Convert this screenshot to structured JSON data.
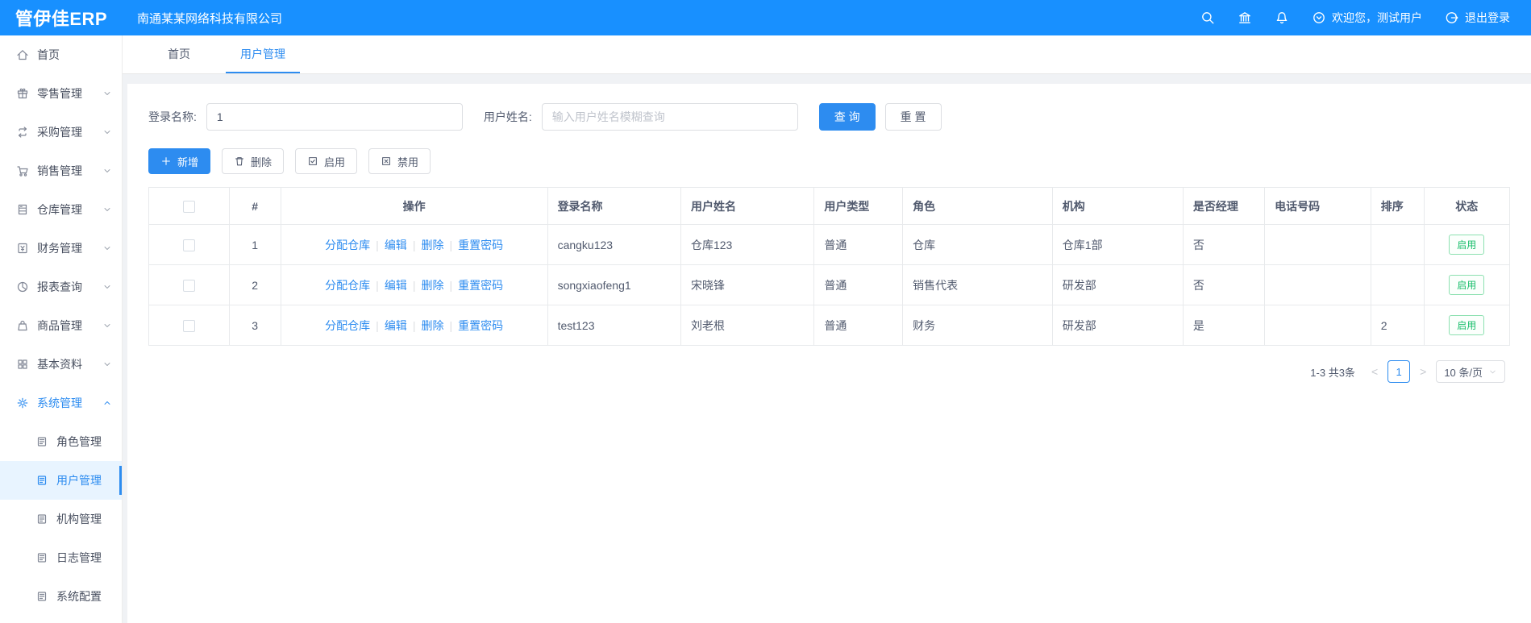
{
  "header": {
    "logo_text": "管伊佳ERP",
    "company_name": "南通某某网络科技有限公司",
    "welcome_text": "欢迎您，测试用户",
    "logout_text": "退出登录"
  },
  "tabs": [
    {
      "label": "首页"
    },
    {
      "label": "用户管理"
    }
  ],
  "sidebar": {
    "items": [
      {
        "id": "home",
        "label": "首页",
        "icon": "home",
        "level": 1
      },
      {
        "id": "retail",
        "label": "零售管理",
        "icon": "gift",
        "level": 1,
        "chevron": "down"
      },
      {
        "id": "purchase",
        "label": "采购管理",
        "icon": "repeat",
        "level": 1,
        "chevron": "down"
      },
      {
        "id": "sales",
        "label": "销售管理",
        "icon": "cart",
        "level": 1,
        "chevron": "down"
      },
      {
        "id": "warehouse",
        "label": "仓库管理",
        "icon": "cabinet",
        "level": 1,
        "chevron": "down"
      },
      {
        "id": "finance",
        "label": "财务管理",
        "icon": "finance",
        "level": 1,
        "chevron": "down"
      },
      {
        "id": "reports",
        "label": "报表查询",
        "icon": "pie",
        "level": 1,
        "chevron": "down"
      },
      {
        "id": "products",
        "label": "商品管理",
        "icon": "bag",
        "level": 1,
        "chevron": "down"
      },
      {
        "id": "basic-data",
        "label": "基本资料",
        "icon": "grid",
        "level": 1,
        "chevron": "down"
      },
      {
        "id": "system",
        "label": "系统管理",
        "icon": "gear",
        "level": 1,
        "chevron": "up",
        "highlight": true
      },
      {
        "id": "role-mgmt",
        "label": "角色管理",
        "icon": "doc",
        "level": 2
      },
      {
        "id": "user-mgmt",
        "label": "用户管理",
        "icon": "doc",
        "level": 2,
        "active": true
      },
      {
        "id": "org-mgmt",
        "label": "机构管理",
        "icon": "doc",
        "level": 2
      },
      {
        "id": "log-mgmt",
        "label": "日志管理",
        "icon": "doc",
        "level": 2
      },
      {
        "id": "system-config",
        "label": "系统配置",
        "icon": "doc",
        "level": 2
      }
    ]
  },
  "search": {
    "login_label": "登录名称:",
    "login_value": "1",
    "name_label": "用户姓名:",
    "name_placeholder": "输入用户姓名模糊查询",
    "query_button": "查 询",
    "reset_button": "重 置"
  },
  "toolbar": {
    "buttons": [
      {
        "id": "add",
        "label": "新增",
        "icon": "plus",
        "primary": true
      },
      {
        "id": "delete",
        "label": "删除",
        "icon": "trash"
      },
      {
        "id": "enable",
        "label": "启用",
        "icon": "check-square"
      },
      {
        "id": "disable",
        "label": "禁用",
        "icon": "x-square"
      }
    ]
  },
  "table": {
    "columns": [
      "#",
      "操作",
      "登录名称",
      "用户姓名",
      "用户类型",
      "角色",
      "机构",
      "是否经理",
      "电话号码",
      "排序",
      "状态"
    ],
    "action_links": [
      "分配仓库",
      "编辑",
      "删除",
      "重置密码"
    ],
    "rows": [
      {
        "index": "1",
        "login_name": "cangku123",
        "user_name": "仓库123",
        "user_type": "普通",
        "role": "仓库",
        "org": "仓库1部",
        "is_manager": "否",
        "phone": "",
        "sort": "",
        "status": "启用"
      },
      {
        "index": "2",
        "login_name": "songxiaofeng1",
        "user_name": "宋晓锋",
        "user_type": "普通",
        "role": "销售代表",
        "org": "研发部",
        "is_manager": "否",
        "phone": "",
        "sort": "",
        "status": "启用"
      },
      {
        "index": "3",
        "login_name": "test123",
        "user_name": "刘老根",
        "user_type": "普通",
        "role": "财务",
        "org": "研发部",
        "is_manager": "是",
        "phone": "",
        "sort": "2",
        "status": "启用"
      }
    ]
  },
  "pagination": {
    "total_text": "1-3 共3条",
    "prev_symbol": "<",
    "current_page": "1",
    "next_symbol": ">",
    "page_size_text": "10 条/页"
  },
  "colors": {
    "header_blue": "#1890ff",
    "accent_blue": "#2d8cf0",
    "status_green": "#19be6b"
  }
}
